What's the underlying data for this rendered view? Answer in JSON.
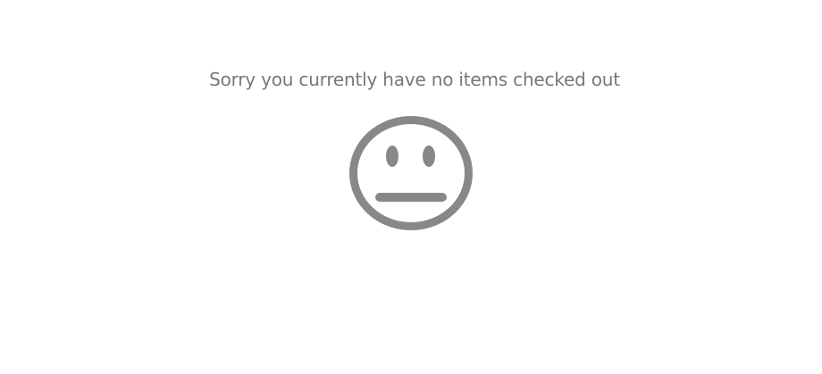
{
  "empty_state": {
    "message": "Sorry you currently have no items checked out",
    "icon": "neutral-face-icon",
    "icon_color": "#888888",
    "text_color": "#777777"
  }
}
